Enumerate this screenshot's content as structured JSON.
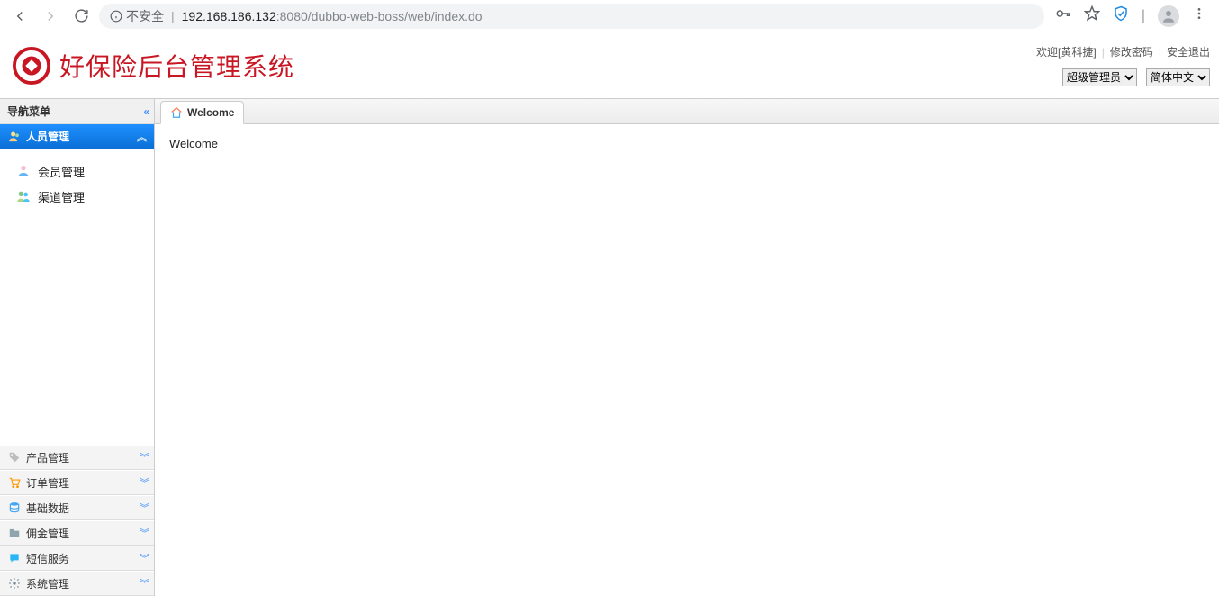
{
  "browser": {
    "insecure_label": "不安全",
    "url_host": "192.168.186.132",
    "url_port_path": ":8080/dubbo-web-boss/web/index.do"
  },
  "header": {
    "brand": "好保险后台管理系统",
    "welcome_prefix": "欢迎[",
    "welcome_user": "黄科捷",
    "welcome_suffix": "]",
    "link_change_pwd": "修改密码",
    "link_logout": "安全退出",
    "role_options": [
      "超级管理员"
    ],
    "lang_options": [
      "简体中文"
    ]
  },
  "sidebar": {
    "title": "导航菜单",
    "sections": [
      {
        "label": "人员管理",
        "active": true
      },
      {
        "label": "产品管理",
        "active": false
      },
      {
        "label": "订单管理",
        "active": false
      },
      {
        "label": "基础数据",
        "active": false
      },
      {
        "label": "佣金管理",
        "active": false
      },
      {
        "label": "短信服务",
        "active": false
      },
      {
        "label": "系统管理",
        "active": false
      }
    ],
    "sub_items": [
      {
        "label": "会员管理"
      },
      {
        "label": "渠道管理"
      }
    ]
  },
  "tabs": {
    "active_tab_label": "Welcome",
    "body_text": "Welcome"
  }
}
